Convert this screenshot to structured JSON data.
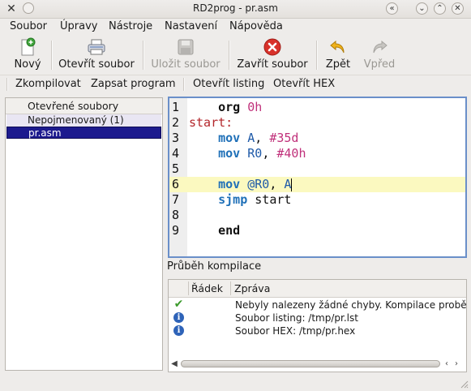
{
  "window": {
    "title": "RD2prog - pr.asm",
    "app_icon": "x-icon",
    "controls": [
      "shade-icon",
      "minimize-icon",
      "maximize-icon",
      "close-icon"
    ]
  },
  "menubar": [
    "Soubor",
    "Úpravy",
    "Nástroje",
    "Nastavení",
    "Nápověda"
  ],
  "toolbar": {
    "new": {
      "label": "Nový",
      "icon": "new-file-icon"
    },
    "open": {
      "label": "Otevřít soubor",
      "icon": "printer-open-icon"
    },
    "save": {
      "label": "Uložit soubor",
      "icon": "floppy-icon",
      "disabled": true
    },
    "close": {
      "label": "Zavřít soubor",
      "icon": "red-close-icon"
    },
    "undo": {
      "label": "Zpět",
      "icon": "undo-arrow-icon"
    },
    "redo": {
      "label": "Vpřed",
      "icon": "redo-arrow-icon",
      "disabled": true
    }
  },
  "toolbar2": {
    "compile": "Zkompilovat",
    "write": "Zapsat program",
    "open_listing": "Otevřít listing",
    "open_hex": "Otevřít HEX"
  },
  "files": {
    "header": "Otevřené soubory",
    "items": [
      "Nepojmenovaný (1)",
      "pr.asm"
    ],
    "selected": "pr.asm"
  },
  "editor": {
    "lines": [
      {
        "n": "1",
        "parts": [
          [
            "kw",
            "    org"
          ],
          [
            "num",
            " 0h"
          ]
        ]
      },
      {
        "n": "2",
        "parts": [
          [
            "lab",
            "start:"
          ]
        ]
      },
      {
        "n": "3",
        "parts": [
          [
            "ins",
            "    mov"
          ],
          [
            "reg",
            " A"
          ],
          [
            "plain",
            ", "
          ],
          [
            "num",
            "#35d"
          ]
        ]
      },
      {
        "n": "4",
        "parts": [
          [
            "ins",
            "    mov"
          ],
          [
            "reg",
            " R0"
          ],
          [
            "plain",
            ", "
          ],
          [
            "num",
            "#40h"
          ]
        ]
      },
      {
        "n": "5",
        "parts": []
      },
      {
        "n": "6",
        "parts": [
          [
            "ins",
            "    mov"
          ],
          [
            "reg",
            " @R0"
          ],
          [
            "plain",
            ", "
          ],
          [
            "reg",
            "A"
          ]
        ]
      },
      {
        "n": "7",
        "parts": [
          [
            "ins",
            "    sjmp"
          ],
          [
            "plain",
            " start"
          ]
        ]
      },
      {
        "n": "8",
        "parts": []
      },
      {
        "n": "9",
        "parts": [
          [
            "kw",
            "    end"
          ]
        ]
      }
    ],
    "current_line": 6
  },
  "compile": {
    "title": "Průběh kompilace",
    "columns": [
      "Řádek",
      "Zpráva"
    ],
    "rows": [
      {
        "icon": "check-icon",
        "line": "",
        "message": "Nebyly nalezeny žádné chyby. Kompilace proběhla úspěšně."
      },
      {
        "icon": "info-icon",
        "line": "",
        "message": "Soubor listing: /tmp/pr.lst"
      },
      {
        "icon": "info-icon",
        "line": "",
        "message": "Soubor HEX: /tmp/pr.hex"
      }
    ]
  },
  "colors": {
    "selection": "#1c1a8e",
    "current_line": "#fbf9c0",
    "instruction": "#1f70b8",
    "number": "#c0307a",
    "label": "#b3262b"
  }
}
